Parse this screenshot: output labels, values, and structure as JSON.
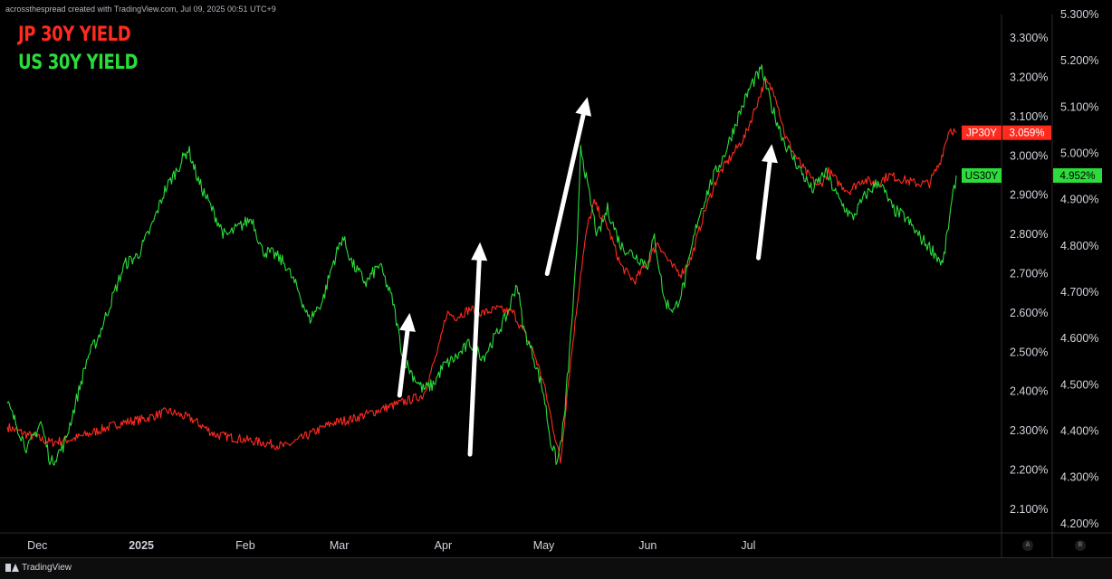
{
  "credit": "acrossthespread created with TradingView.com, Jul 09, 2025 00:51 UTC+9",
  "footer": {
    "brand": "TradingView"
  },
  "axis_buttons": [
    "A",
    "B"
  ],
  "colors": {
    "jp": "#ff2b1f",
    "us": "#2bdc3a",
    "arrow": "#ffffff",
    "background": "#000000",
    "grid": "#1a1a1a"
  },
  "chart_data": {
    "type": "line",
    "legend_placement": "top-left",
    "legend": [
      "JP 30Y YIELD",
      "US 30Y YIELD"
    ],
    "grid": false,
    "x_axis": {
      "ticks": [
        {
          "label": "Dec",
          "date": "2024-12-01"
        },
        {
          "label": "2025",
          "date": "2025-01-01",
          "bold": true
        },
        {
          "label": "Feb",
          "date": "2025-02-01"
        },
        {
          "label": "Mar",
          "date": "2025-03-01"
        },
        {
          "label": "Apr",
          "date": "2025-04-01"
        },
        {
          "label": "May",
          "date": "2025-05-01"
        },
        {
          "label": "Jun",
          "date": "2025-06-01"
        },
        {
          "label": "Jul",
          "date": "2025-07-01"
        }
      ],
      "range": [
        "2024-11-22",
        "2025-07-09"
      ]
    },
    "y_axis_jp": {
      "range": [
        2.04,
        3.36
      ],
      "ticks": [
        "2.100%",
        "2.200%",
        "2.300%",
        "2.400%",
        "2.500%",
        "2.600%",
        "2.700%",
        "2.800%",
        "2.900%",
        "3.000%",
        "3.100%",
        "3.200%",
        "3.300%"
      ],
      "tick_values": [
        2.1,
        2.2,
        2.3,
        2.4,
        2.5,
        2.6,
        2.7,
        2.8,
        2.9,
        3.0,
        3.1,
        3.2,
        3.3
      ]
    },
    "y_axis_us": {
      "range": [
        4.18,
        5.3
      ],
      "ticks": [
        "4.200%",
        "4.300%",
        "4.400%",
        "4.500%",
        "4.600%",
        "4.700%",
        "4.800%",
        "4.900%",
        "5.000%",
        "5.100%",
        "5.200%",
        "5.300%"
      ],
      "tick_values": [
        4.2,
        4.3,
        4.4,
        4.5,
        4.6,
        4.7,
        4.8,
        4.9,
        5.0,
        5.1,
        5.2,
        5.3
      ]
    },
    "series": [
      {
        "name": "JP 30Y YIELD",
        "axis": "jp",
        "tag": "JP30Y",
        "last_label": "3.059%",
        "last": 3.059,
        "points": [
          [
            "2024-11-22",
            2.31
          ],
          [
            "2024-11-28",
            2.29
          ],
          [
            "2024-12-05",
            2.27
          ],
          [
            "2024-12-12",
            2.28
          ],
          [
            "2024-12-19",
            2.3
          ],
          [
            "2024-12-26",
            2.32
          ],
          [
            "2025-01-02",
            2.33
          ],
          [
            "2025-01-09",
            2.35
          ],
          [
            "2025-01-16",
            2.33
          ],
          [
            "2025-01-23",
            2.29
          ],
          [
            "2025-01-30",
            2.28
          ],
          [
            "2025-02-06",
            2.27
          ],
          [
            "2025-02-13",
            2.26
          ],
          [
            "2025-02-20",
            2.29
          ],
          [
            "2025-02-27",
            2.32
          ],
          [
            "2025-03-05",
            2.33
          ],
          [
            "2025-03-12",
            2.35
          ],
          [
            "2025-03-19",
            2.37
          ],
          [
            "2025-03-26",
            2.39
          ],
          [
            "2025-03-28",
            2.44
          ],
          [
            "2025-03-31",
            2.52
          ],
          [
            "2025-04-02",
            2.6
          ],
          [
            "2025-04-05",
            2.59
          ],
          [
            "2025-04-09",
            2.61
          ],
          [
            "2025-04-13",
            2.6
          ],
          [
            "2025-04-17",
            2.61
          ],
          [
            "2025-04-22",
            2.6
          ],
          [
            "2025-04-25",
            2.55
          ],
          [
            "2025-04-28",
            2.5
          ],
          [
            "2025-05-01",
            2.42
          ],
          [
            "2025-05-04",
            2.3
          ],
          [
            "2025-05-06",
            2.22
          ],
          [
            "2025-05-08",
            2.4
          ],
          [
            "2025-05-10",
            2.55
          ],
          [
            "2025-05-12",
            2.7
          ],
          [
            "2025-05-14",
            2.82
          ],
          [
            "2025-05-16",
            2.88
          ],
          [
            "2025-05-20",
            2.82
          ],
          [
            "2025-05-24",
            2.72
          ],
          [
            "2025-05-28",
            2.68
          ],
          [
            "2025-06-01",
            2.73
          ],
          [
            "2025-06-04",
            2.78
          ],
          [
            "2025-06-08",
            2.72
          ],
          [
            "2025-06-11",
            2.7
          ],
          [
            "2025-06-14",
            2.74
          ],
          [
            "2025-06-18",
            2.86
          ],
          [
            "2025-06-22",
            2.95
          ],
          [
            "2025-06-26",
            3.0
          ],
          [
            "2025-06-30",
            3.05
          ],
          [
            "2025-07-03",
            3.12
          ],
          [
            "2025-07-06",
            3.19
          ],
          [
            "2025-07-09",
            3.16
          ],
          [
            "2025-07-12",
            3.05
          ],
          [
            "2025-07-15",
            3.0
          ],
          [
            "2025-07-18",
            2.96
          ],
          [
            "2025-07-22",
            2.92
          ],
          [
            "2025-07-25",
            2.96
          ],
          [
            "2025-07-28",
            2.93
          ],
          [
            "2025-07-31",
            2.91
          ],
          [
            "2025-08-04",
            2.94
          ],
          [
            "2025-08-08",
            2.93
          ],
          [
            "2025-08-12",
            2.95
          ],
          [
            "2025-08-16",
            2.94
          ],
          [
            "2025-08-20",
            2.93
          ],
          [
            "2025-08-24",
            2.93
          ],
          [
            "2025-08-27",
            2.98
          ],
          [
            "2025-08-30",
            3.07
          ],
          [
            "2025-09-01",
            3.059
          ]
        ]
      },
      {
        "name": "US 30Y YIELD",
        "axis": "us",
        "tag": "US30Y",
        "last_label": "4.952%",
        "last": 4.952,
        "points": [
          [
            "2024-11-22",
            4.46
          ],
          [
            "2024-11-28",
            4.36
          ],
          [
            "2024-12-02",
            4.42
          ],
          [
            "2024-12-05",
            4.33
          ],
          [
            "2024-12-09",
            4.37
          ],
          [
            "2024-12-12",
            4.45
          ],
          [
            "2024-12-16",
            4.56
          ],
          [
            "2024-12-19",
            4.6
          ],
          [
            "2024-12-23",
            4.68
          ],
          [
            "2024-12-27",
            4.76
          ],
          [
            "2024-12-31",
            4.78
          ],
          [
            "2025-01-04",
            4.84
          ],
          [
            "2025-01-08",
            4.92
          ],
          [
            "2025-01-12",
            4.97
          ],
          [
            "2025-01-15",
            5.01
          ],
          [
            "2025-01-18",
            4.94
          ],
          [
            "2025-01-22",
            4.88
          ],
          [
            "2025-01-26",
            4.82
          ],
          [
            "2025-01-30",
            4.84
          ],
          [
            "2025-02-03",
            4.86
          ],
          [
            "2025-02-06",
            4.79
          ],
          [
            "2025-02-10",
            4.78
          ],
          [
            "2025-02-13",
            4.76
          ],
          [
            "2025-02-17",
            4.7
          ],
          [
            "2025-02-20",
            4.64
          ],
          [
            "2025-02-24",
            4.68
          ],
          [
            "2025-02-27",
            4.76
          ],
          [
            "2025-03-02",
            4.82
          ],
          [
            "2025-03-05",
            4.76
          ],
          [
            "2025-03-09",
            4.72
          ],
          [
            "2025-03-13",
            4.76
          ],
          [
            "2025-03-17",
            4.68
          ],
          [
            "2025-03-20",
            4.56
          ],
          [
            "2025-03-23",
            4.52
          ],
          [
            "2025-03-26",
            4.49
          ],
          [
            "2025-03-29",
            4.5
          ],
          [
            "2025-04-01",
            4.54
          ],
          [
            "2025-04-05",
            4.56
          ],
          [
            "2025-04-09",
            4.59
          ],
          [
            "2025-04-13",
            4.56
          ],
          [
            "2025-04-17",
            4.61
          ],
          [
            "2025-04-20",
            4.65
          ],
          [
            "2025-04-23",
            4.72
          ],
          [
            "2025-04-25",
            4.62
          ],
          [
            "2025-04-28",
            4.56
          ],
          [
            "2025-05-01",
            4.48
          ],
          [
            "2025-05-03",
            4.38
          ],
          [
            "2025-05-05",
            4.33
          ],
          [
            "2025-05-07",
            4.42
          ],
          [
            "2025-05-09",
            4.6
          ],
          [
            "2025-05-11",
            4.8
          ],
          [
            "2025-05-12",
            5.02
          ],
          [
            "2025-05-14",
            4.93
          ],
          [
            "2025-05-17",
            4.82
          ],
          [
            "2025-05-20",
            4.88
          ],
          [
            "2025-05-24",
            4.8
          ],
          [
            "2025-05-28",
            4.78
          ],
          [
            "2025-06-01",
            4.76
          ],
          [
            "2025-06-03",
            4.82
          ],
          [
            "2025-06-06",
            4.68
          ],
          [
            "2025-06-09",
            4.66
          ],
          [
            "2025-06-12",
            4.72
          ],
          [
            "2025-06-16",
            4.86
          ],
          [
            "2025-06-20",
            4.94
          ],
          [
            "2025-06-24",
            5.0
          ],
          [
            "2025-06-28",
            5.08
          ],
          [
            "2025-07-02",
            5.15
          ],
          [
            "2025-07-05",
            5.18
          ],
          [
            "2025-07-08",
            5.1
          ],
          [
            "2025-07-12",
            5.02
          ],
          [
            "2025-07-16",
            4.97
          ],
          [
            "2025-07-20",
            4.92
          ],
          [
            "2025-07-24",
            4.96
          ],
          [
            "2025-07-28",
            4.9
          ],
          [
            "2025-08-01",
            4.86
          ],
          [
            "2025-08-05",
            4.91
          ],
          [
            "2025-08-09",
            4.94
          ],
          [
            "2025-08-13",
            4.88
          ],
          [
            "2025-08-17",
            4.86
          ],
          [
            "2025-08-21",
            4.82
          ],
          [
            "2025-08-25",
            4.79
          ],
          [
            "2025-08-28",
            4.76
          ],
          [
            "2025-08-30",
            4.86
          ],
          [
            "2025-09-01",
            4.952
          ]
        ]
      }
    ],
    "arrows": [
      {
        "from": [
          "2025-03-19",
          2.39
        ],
        "to": [
          "2025-03-22",
          2.6
        ],
        "axis": "jp"
      },
      {
        "from": [
          "2025-04-09",
          2.24
        ],
        "to": [
          "2025-04-12",
          2.78
        ],
        "axis": "jp"
      },
      {
        "from": [
          "2025-05-02",
          2.7
        ],
        "to": [
          "2025-05-14",
          3.15
        ],
        "axis": "jp"
      },
      {
        "from": [
          "2025-07-04",
          2.74
        ],
        "to": [
          "2025-07-08",
          3.03
        ],
        "axis": "jp"
      }
    ]
  }
}
